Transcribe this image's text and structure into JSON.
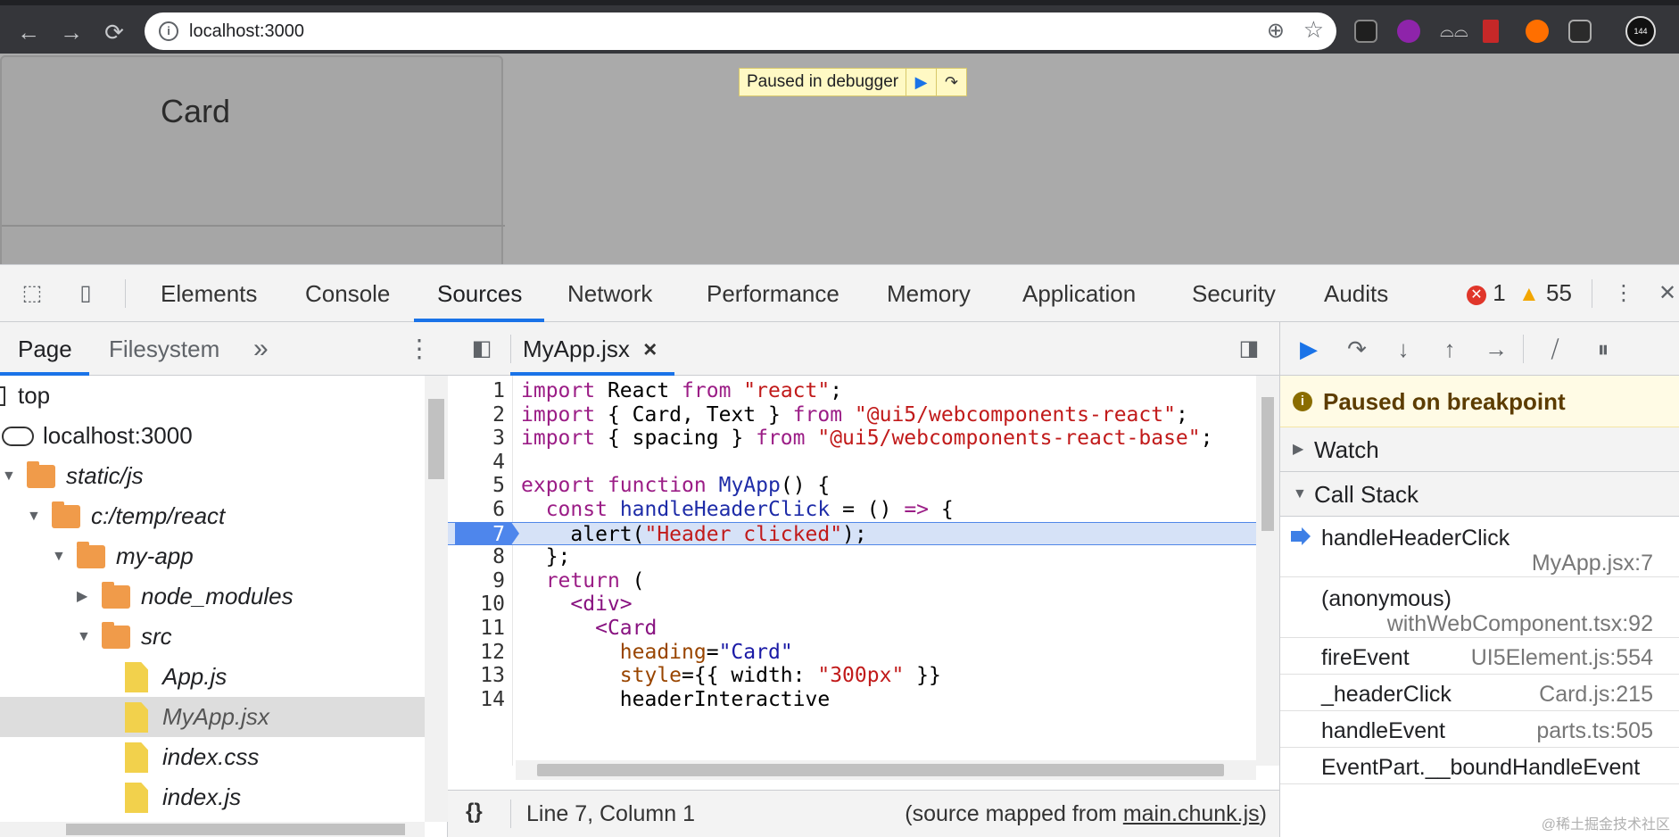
{
  "browser": {
    "url": "localhost:3000",
    "back_icon": "←",
    "forward_icon": "→",
    "reload_icon": "⟳",
    "avatar_text": "144"
  },
  "page": {
    "card_title": "Card",
    "paused_banner": "Paused in debugger"
  },
  "devtools": {
    "tabs": [
      "Elements",
      "Console",
      "Sources",
      "Network",
      "Performance",
      "Memory",
      "Application",
      "Security",
      "Audits"
    ],
    "active_tab": "Sources",
    "errors": "1",
    "warnings": "55"
  },
  "navigator": {
    "tabs": [
      "Page",
      "Filesystem"
    ],
    "more": "»",
    "tree": [
      {
        "label": "top",
        "kind": "frame",
        "level": 0,
        "expanded": null
      },
      {
        "label": "localhost:3000",
        "kind": "cloud",
        "level": 0,
        "expanded": null
      },
      {
        "label": "static/js",
        "kind": "folder",
        "level": 0,
        "expanded": true
      },
      {
        "label": "c:/temp/react",
        "kind": "folder",
        "level": 1,
        "expanded": true
      },
      {
        "label": "my-app",
        "kind": "folder",
        "level": 2,
        "expanded": true
      },
      {
        "label": "node_modules",
        "kind": "folder",
        "level": 3,
        "expanded": false
      },
      {
        "label": "src",
        "kind": "folder",
        "level": 3,
        "expanded": true
      },
      {
        "label": "App.js",
        "kind": "file",
        "level": 4,
        "expanded": null
      },
      {
        "label": "MyApp.jsx",
        "kind": "file",
        "level": 4,
        "expanded": null,
        "selected": true
      },
      {
        "label": "index.css",
        "kind": "file",
        "level": 4,
        "expanded": null
      },
      {
        "label": "index.js",
        "kind": "file",
        "level": 4,
        "expanded": null
      }
    ]
  },
  "editor": {
    "file_tab": "MyApp.jsx",
    "close": "×",
    "breakpoint_line": 7,
    "lines": [
      [
        {
          "t": "import",
          "c": "kw"
        },
        {
          "t": " React "
        },
        {
          "t": "from",
          "c": "kw"
        },
        {
          "t": " "
        },
        {
          "t": "\"react\"",
          "c": "str"
        },
        {
          "t": ";"
        }
      ],
      [
        {
          "t": "import",
          "c": "kw"
        },
        {
          "t": " { Card, Text } "
        },
        {
          "t": "from",
          "c": "kw"
        },
        {
          "t": " "
        },
        {
          "t": "\"@ui5/webcomponents-react\"",
          "c": "str"
        },
        {
          "t": ";"
        }
      ],
      [
        {
          "t": "import",
          "c": "kw"
        },
        {
          "t": " { spacing } "
        },
        {
          "t": "from",
          "c": "kw"
        },
        {
          "t": " "
        },
        {
          "t": "\"@ui5/webcomponents-react-base\"",
          "c": "str"
        },
        {
          "t": ";"
        }
      ],
      [],
      [
        {
          "t": "export",
          "c": "kw"
        },
        {
          "t": " "
        },
        {
          "t": "function",
          "c": "kw"
        },
        {
          "t": " "
        },
        {
          "t": "MyApp",
          "c": "def"
        },
        {
          "t": "() {"
        }
      ],
      [
        {
          "t": "  "
        },
        {
          "t": "const",
          "c": "kw"
        },
        {
          "t": " "
        },
        {
          "t": "handleHeaderClick",
          "c": "def"
        },
        {
          "t": " = () "
        },
        {
          "t": "=>",
          "c": "kw"
        },
        {
          "t": " {"
        }
      ],
      [
        {
          "t": "    alert("
        },
        {
          "t": "\"Header clicked\"",
          "c": "str"
        },
        {
          "t": ");"
        }
      ],
      [
        {
          "t": "  };"
        }
      ],
      [
        {
          "t": "  "
        },
        {
          "t": "return",
          "c": "kw"
        },
        {
          "t": " ("
        }
      ],
      [
        {
          "t": "    "
        },
        {
          "t": "<div>",
          "c": "tag"
        }
      ],
      [
        {
          "t": "      "
        },
        {
          "t": "<Card",
          "c": "tag"
        }
      ],
      [
        {
          "t": "        "
        },
        {
          "t": "heading",
          "c": "attr"
        },
        {
          "t": "="
        },
        {
          "t": "\"Card\"",
          "c": "atv"
        }
      ],
      [
        {
          "t": "        "
        },
        {
          "t": "style",
          "c": "attr"
        },
        {
          "t": "={{ width: "
        },
        {
          "t": "\"300px\"",
          "c": "str"
        },
        {
          "t": " }}"
        }
      ],
      [
        {
          "t": "        headerInteractive"
        }
      ]
    ],
    "status": "Line 7, Column 1",
    "source_map_prefix": "(source mapped from ",
    "source_map_link": "main.chunk.js",
    "source_map_suffix": ")"
  },
  "debugger": {
    "paused_msg": "Paused on breakpoint",
    "watch": "Watch",
    "call_stack": "Call Stack",
    "frames": [
      {
        "fn": "handleHeaderClick",
        "loc": "MyApp.jsx:7",
        "current": true,
        "two_line": true
      },
      {
        "fn": "(anonymous)",
        "loc": "withWebComponent.tsx:92",
        "current": false,
        "two_line": true
      },
      {
        "fn": "fireEvent",
        "loc": "UI5Element.js:554",
        "current": false,
        "two_line": false
      },
      {
        "fn": "_headerClick",
        "loc": "Card.js:215",
        "current": false,
        "two_line": false
      },
      {
        "fn": "handleEvent",
        "loc": "parts.ts:505",
        "current": false,
        "two_line": false
      },
      {
        "fn": "EventPart.__boundHandleEvent",
        "loc": "",
        "current": false,
        "two_line": false
      }
    ]
  },
  "watermark": "@稀土掘金技术社区"
}
